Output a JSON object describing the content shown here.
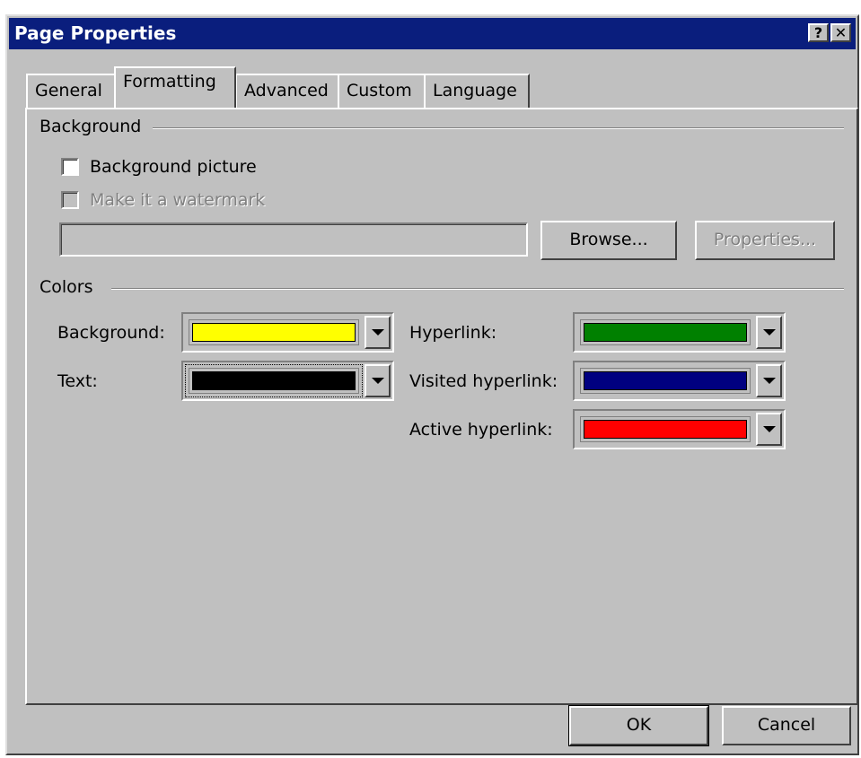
{
  "window": {
    "title": "Page Properties",
    "help_label": "?",
    "close_label": "✕"
  },
  "tabs": [
    {
      "label": "General"
    },
    {
      "label": "Formatting",
      "active": true
    },
    {
      "label": "Advanced"
    },
    {
      "label": "Custom"
    },
    {
      "label": "Language"
    }
  ],
  "background_group": {
    "title": "Background",
    "background_picture": {
      "label": "Background picture",
      "checked": false
    },
    "watermark": {
      "label": "Make it a watermark",
      "checked": false,
      "disabled": true
    },
    "path_value": "",
    "browse_label": "Browse...",
    "properties_label": "Properties..."
  },
  "colors_group": {
    "title": "Colors",
    "background": {
      "label": "Background:",
      "color": "#ffff00"
    },
    "text": {
      "label": "Text:",
      "color": "#000000"
    },
    "hyperlink": {
      "label": "Hyperlink:",
      "color": "#008000"
    },
    "visited_hyperlink": {
      "label": "Visited hyperlink:",
      "color": "#000080"
    },
    "active_hyperlink": {
      "label": "Active hyperlink:",
      "color": "#ff0000"
    }
  },
  "footer": {
    "ok_label": "OK",
    "cancel_label": "Cancel"
  }
}
